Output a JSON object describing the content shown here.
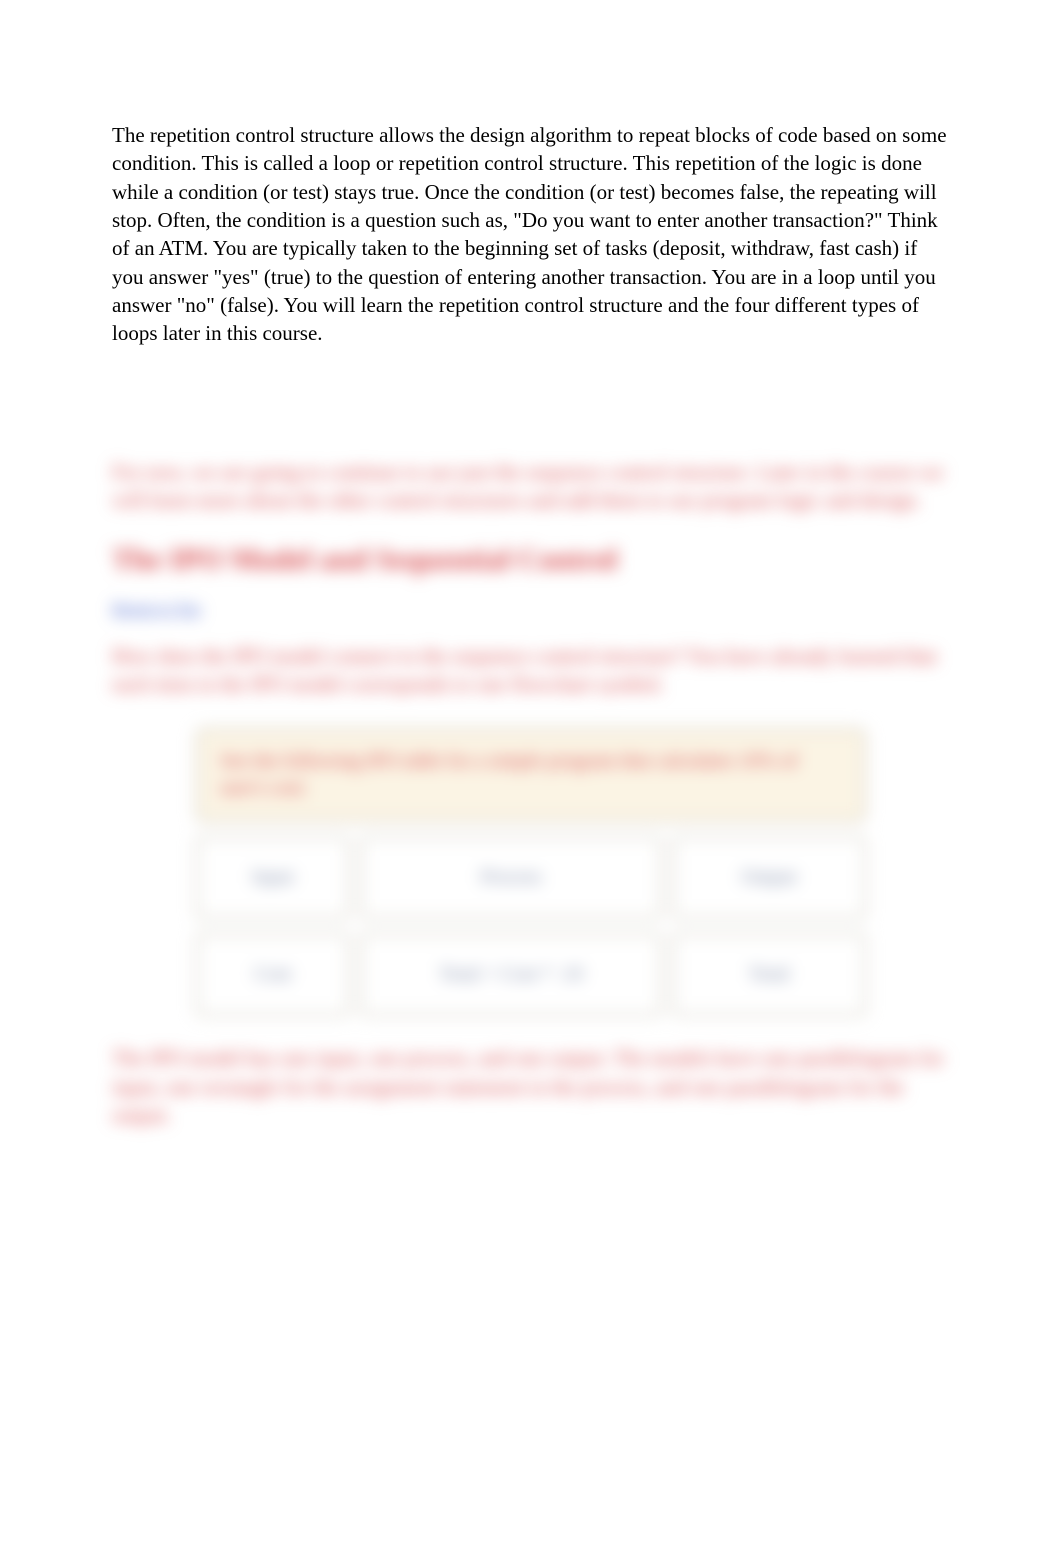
{
  "intro": "The repetition control structure allows the design algorithm to repeat blocks of code based on some condition. This is called a loop or repetition control structure. This repetition of the logic is done while a condition (or test) stays true. Once the condition (or test) becomes false, the repeating will stop. Often, the condition is a question such as, \"Do you want to enter another transaction?\" Think of an ATM. You are typically taken to the beginning set of tasks (deposit, withdraw, fast cash) if you answer \"yes\" (true) to the question of entering another transaction. You are in a loop until you answer \"no\" (false). You will learn the repetition control structure and the four different types of loops later in this course.",
  "blurred": {
    "lead": "For now, we are going to continue to use just the sequence control structure. Later in the course we will learn more about the other control structures and add them to our program logic and design.",
    "heading": "The IPO Model and Sequential Control",
    "link": "Return to Top",
    "para2": "How does the IPO model connect to the sequence control structure? You have already learned that each item in the IPO model corresponds to one flowchart symbol.",
    "tableCaption": "See the following IPO table for a simple program that calculates 10% of user's cost:",
    "headers": {
      "c1": "Input",
      "c2": "Process",
      "c3": "Output"
    },
    "row": {
      "c1": "Cost",
      "c2": "Total = Cost * .10",
      "c3": "Total"
    },
    "closing": "The IPO model has one input, one process, and one output. The models have one parallelogram for input, one rectangle for the assignment statement in the process, and one parallelogram for the output."
  }
}
